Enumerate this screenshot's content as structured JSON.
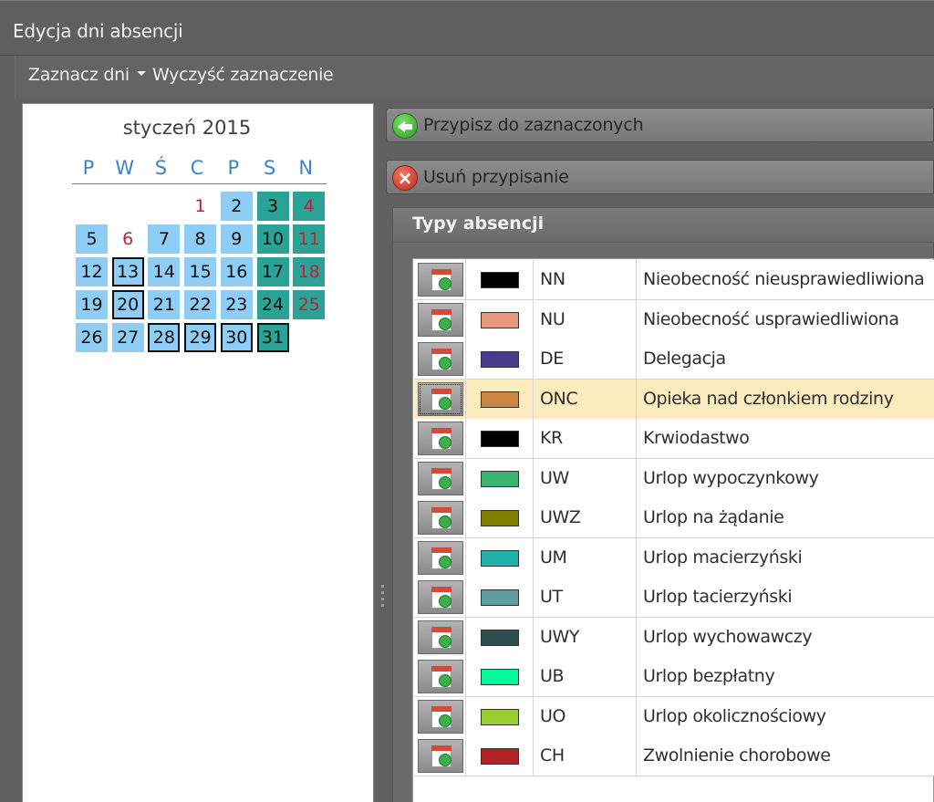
{
  "window": {
    "title": "Edycja dni absencji"
  },
  "toolbar": {
    "select_days": "Zaznacz dni",
    "clear_selection": "Wyczyść zaznaczenie"
  },
  "calendar": {
    "month_label": "styczeń 2015",
    "weekdays": [
      "P",
      "W",
      "Ś",
      "C",
      "P",
      "S",
      "N"
    ],
    "weeks": [
      [
        null,
        null,
        null,
        {
          "d": "1",
          "fill": "none",
          "sunday_red": true
        },
        {
          "d": "2",
          "fill": "blue"
        },
        {
          "d": "3",
          "fill": "teal"
        },
        {
          "d": "4",
          "fill": "teal",
          "sunday_red": true
        }
      ],
      [
        {
          "d": "5",
          "fill": "blue"
        },
        {
          "d": "6",
          "fill": "none",
          "sunday_red": true
        },
        {
          "d": "7",
          "fill": "blue"
        },
        {
          "d": "8",
          "fill": "blue"
        },
        {
          "d": "9",
          "fill": "blue"
        },
        {
          "d": "10",
          "fill": "teal"
        },
        {
          "d": "11",
          "fill": "teal",
          "sunday_red": true
        }
      ],
      [
        {
          "d": "12",
          "fill": "blue"
        },
        {
          "d": "13",
          "fill": "blue",
          "selected": true
        },
        {
          "d": "14",
          "fill": "blue"
        },
        {
          "d": "15",
          "fill": "blue"
        },
        {
          "d": "16",
          "fill": "blue"
        },
        {
          "d": "17",
          "fill": "teal"
        },
        {
          "d": "18",
          "fill": "teal",
          "sunday_red": true
        }
      ],
      [
        {
          "d": "19",
          "fill": "blue"
        },
        {
          "d": "20",
          "fill": "blue",
          "selected": true
        },
        {
          "d": "21",
          "fill": "blue"
        },
        {
          "d": "22",
          "fill": "blue"
        },
        {
          "d": "23",
          "fill": "blue"
        },
        {
          "d": "24",
          "fill": "teal"
        },
        {
          "d": "25",
          "fill": "teal",
          "sunday_red": true
        }
      ],
      [
        {
          "d": "26",
          "fill": "blue"
        },
        {
          "d": "27",
          "fill": "blue"
        },
        {
          "d": "28",
          "fill": "blue",
          "selected": true
        },
        {
          "d": "29",
          "fill": "blue",
          "selected": true
        },
        {
          "d": "30",
          "fill": "blue",
          "selected": true
        },
        {
          "d": "31",
          "fill": "teal",
          "selected": true
        },
        null
      ]
    ]
  },
  "actions": {
    "assign_label": "Przypisz do zaznaczonych",
    "remove_label": "Usuń przypisanie"
  },
  "absence_types": {
    "header": "Typy absencji",
    "rows": [
      {
        "code": "NN",
        "name": "Nieobecność nieusprawiedliwiona",
        "color": "#000000"
      },
      {
        "code": "NU",
        "name": "Nieobecność usprawiedliwiona",
        "color": "#e9967a"
      },
      {
        "code": "DE",
        "name": "Delegacja",
        "color": "#483d8b"
      },
      {
        "code": "ONC",
        "name": "Opieka nad członkiem rodziny",
        "color": "#cd853f",
        "highlighted": true
      },
      {
        "code": "KR",
        "name": "Krwiodastwo",
        "color": "#000000"
      },
      {
        "code": "UW",
        "name": "Urlop wypoczynkowy",
        "color": "#3cb371"
      },
      {
        "code": "UWZ",
        "name": "Urlop na żądanie",
        "color": "#808000"
      },
      {
        "code": "UM",
        "name": "Urlop macierzyński",
        "color": "#20b2aa"
      },
      {
        "code": "UT",
        "name": "Urlop tacierzyński",
        "color": "#5f9ea0"
      },
      {
        "code": "UWY",
        "name": "Urlop wychowawczy",
        "color": "#2f4f4f"
      },
      {
        "code": "UB",
        "name": "Urlop bezpłatny",
        "color": "#00fa9a"
      },
      {
        "code": "UO",
        "name": "Urlop okolicznościowy",
        "color": "#9acd32"
      },
      {
        "code": "CH",
        "name": "Zwolnienie chorobowe",
        "color": "#b22222"
      }
    ]
  }
}
